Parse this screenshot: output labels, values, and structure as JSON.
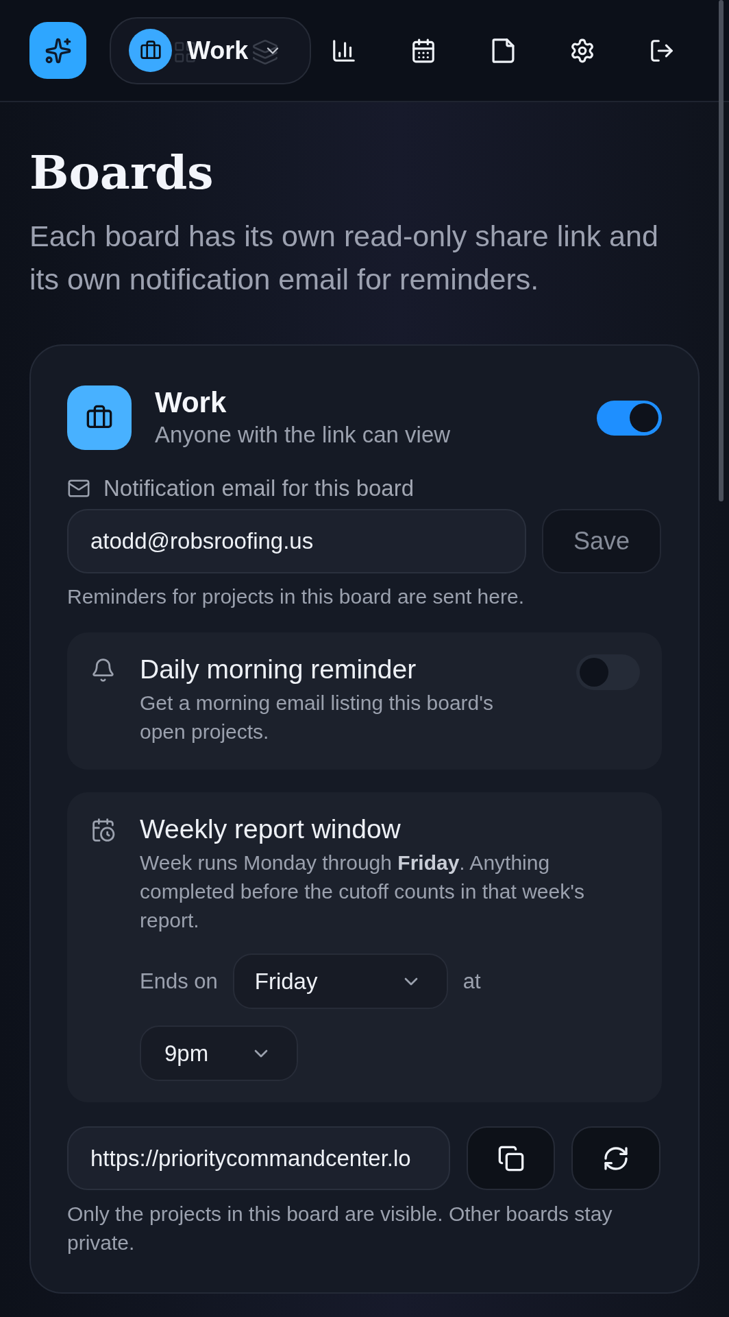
{
  "top_bar": {
    "workspace_switcher": {
      "label": "Work"
    }
  },
  "page": {
    "title": "Boards",
    "subtitle": "Each board has its own read-only share link and its own notification email for reminders."
  },
  "board_card": {
    "name": "Work",
    "visibility": "Anyone with the link can view",
    "sharing": {
      "on": true
    },
    "notification_email": {
      "label": "Notification email for this board",
      "value": "atodd@robsroofing.us",
      "hint": "Reminders for projects in this board are sent here."
    },
    "save_button": {
      "label": "Save",
      "disabled": true
    },
    "settings": [
      {
        "kind": "toggle",
        "title": "Daily morning reminder",
        "description": "Get a morning email listing this board's open projects.",
        "on": false
      },
      {
        "kind": "schedule",
        "title": "Weekly report window",
        "description": "Week runs Monday through **Friday**. Anything completed before the cutoff counts in that week's report.",
        "ends_on_label": "Ends on",
        "day": "Friday",
        "at_label": "at",
        "time": "9pm"
      }
    ],
    "share_link": {
      "value": "https://prioritycommandcenter.lo",
      "hint": "Only the projects in this board are visible. Other boards stay private."
    }
  }
}
